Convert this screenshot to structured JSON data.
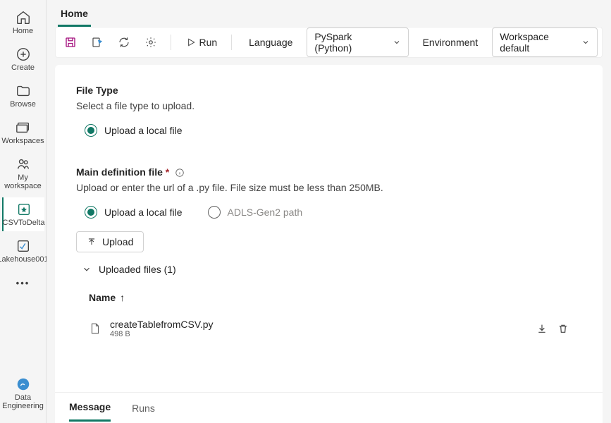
{
  "sidebar": {
    "home": "Home",
    "create": "Create",
    "browse": "Browse",
    "workspaces": "Workspaces",
    "my_workspace": "My workspace",
    "csvtodelta": "CSVToDelta",
    "lakehouse": "Lakehouse001",
    "bottom": "Data Engineering"
  },
  "tab": {
    "home": "Home"
  },
  "toolbar": {
    "run": "Run",
    "language_label": "Language",
    "language_value": "PySpark (Python)",
    "environment_label": "Environment",
    "environment_value": "Workspace default"
  },
  "file_type": {
    "title": "File Type",
    "desc": "Select a file type to upload.",
    "option_local": "Upload a local file"
  },
  "main_def": {
    "title": "Main definition file ",
    "desc": "Upload or enter the url of a .py file. File size must be less than 250MB.",
    "option_local": "Upload a local file",
    "option_adls": "ADLS-Gen2 path",
    "upload_btn": "Upload",
    "uploaded_header": "Uploaded files (1)",
    "table_name": "Name",
    "file": {
      "name": "createTablefromCSV.py",
      "size": "498 B"
    }
  },
  "bottom_tabs": {
    "message": "Message",
    "runs": "Runs"
  }
}
